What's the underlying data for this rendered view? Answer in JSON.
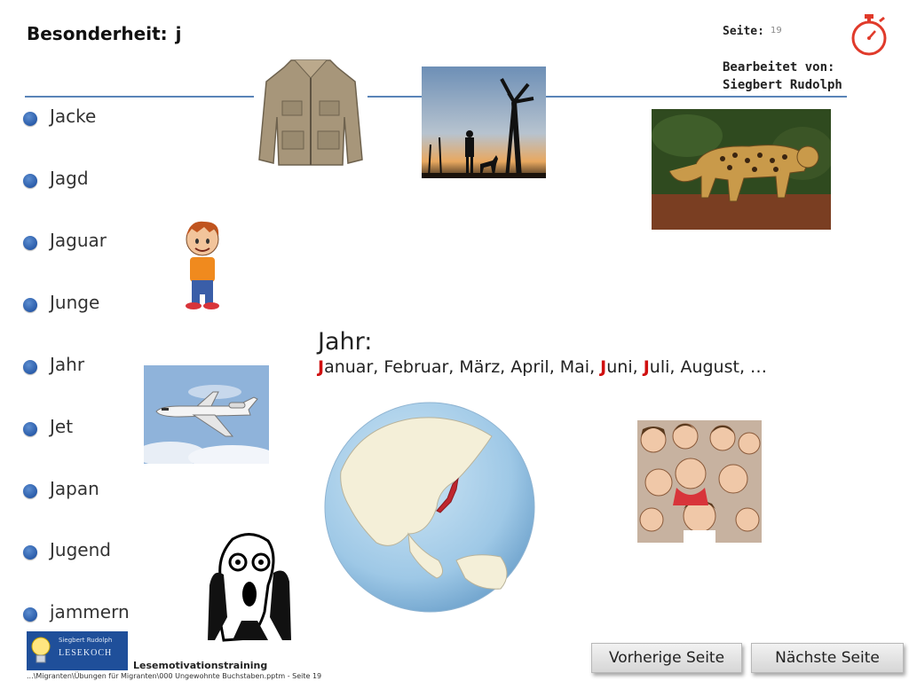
{
  "header": {
    "title": "Besonderheit:",
    "title_letter": "j",
    "page_label": "Seite:",
    "page_number": "19",
    "edited_by_label": "Bearbeitet von:",
    "edited_by_name": "Siegbert Rudolph"
  },
  "words": [
    "Jacke",
    "Jagd",
    "Jaguar",
    "Junge",
    "Jahr",
    "Jet",
    "Japan",
    "Jugend",
    "jammern"
  ],
  "jahr": {
    "title": "Jahr:",
    "months": [
      {
        "hl": "J",
        "rest": "anuar, Februar, März, April, Mai, "
      },
      {
        "hl": "J",
        "rest": "uni, "
      },
      {
        "hl": "J",
        "rest": "uli, August, …"
      }
    ]
  },
  "icons": {
    "timer": "stopwatch-icon",
    "bullet": "blue-circle-bullet"
  },
  "colors": {
    "accent_line": "#5a84b8",
    "highlight_red": "#d01010",
    "timer_red": "#e03a2a",
    "bullet_blue": "#2a5caa"
  },
  "footer": {
    "logo_small": "Siegbert Rudolph",
    "logo_big": "LESEKOCH",
    "course": "Lesemotivationstraining",
    "path": "...\\Migranten\\Übungen für Migranten\\000 Ungewohnte Buchstaben.pptm - Seite 19"
  },
  "nav": {
    "prev": "Vorherige Seite",
    "next": "Nächste Seite"
  }
}
